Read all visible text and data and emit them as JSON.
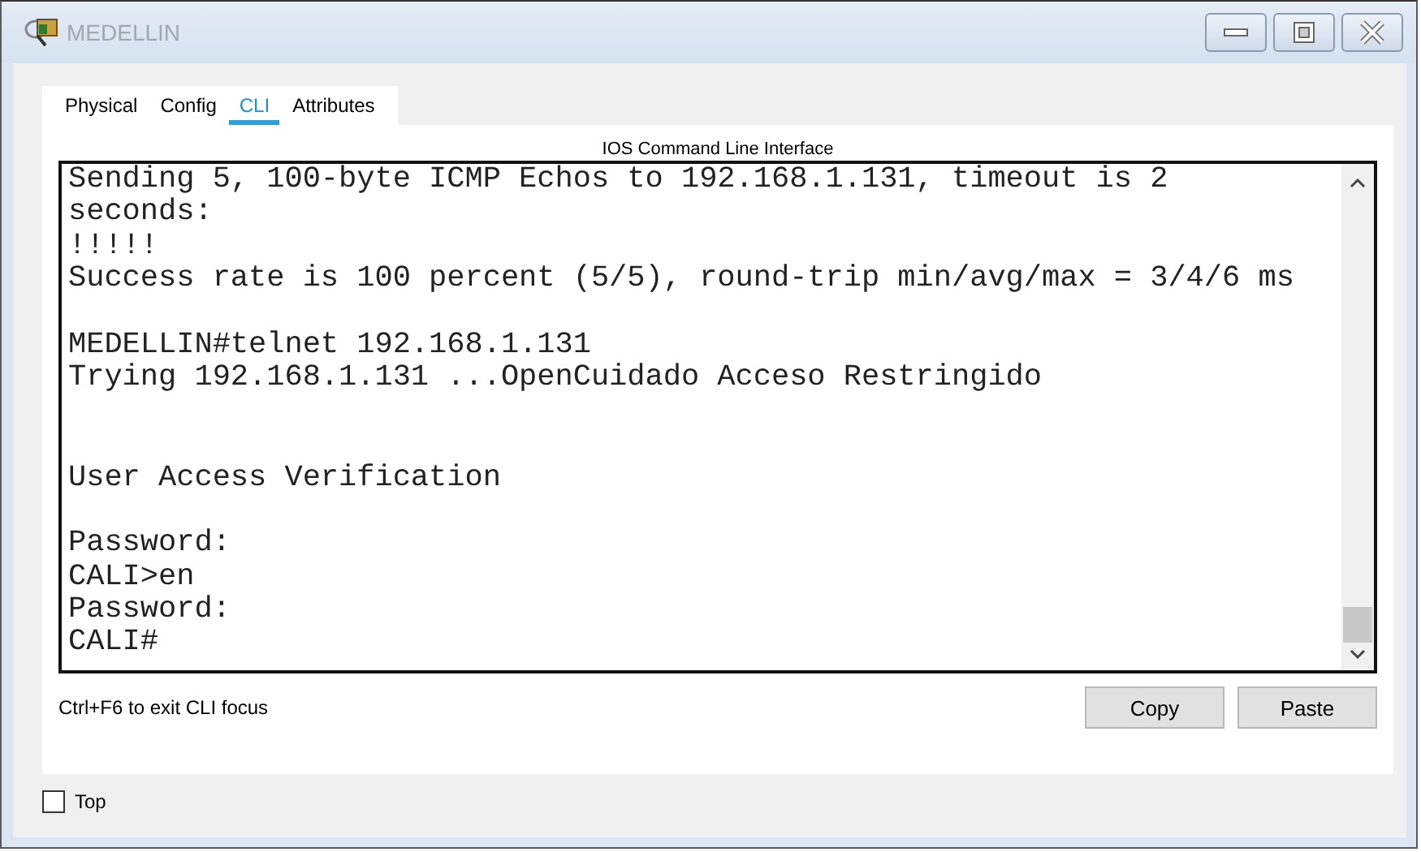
{
  "window": {
    "title": "MEDELLIN"
  },
  "tabs": [
    {
      "label": "Physical",
      "selected": false
    },
    {
      "label": "Config",
      "selected": false
    },
    {
      "label": "CLI",
      "selected": true
    },
    {
      "label": "Attributes",
      "selected": false
    }
  ],
  "cli": {
    "heading": "IOS Command Line Interface",
    "lines": [
      {
        "kind": "text",
        "text": "Sending 5, 100-byte ICMP Echos to 192.168.1.131, timeout is 2"
      },
      {
        "kind": "text",
        "text": "seconds:"
      },
      {
        "kind": "text",
        "text": "!!!!!"
      },
      {
        "kind": "text",
        "text": "Success rate is 100 percent (5/5), round-trip min/avg/max = 3/4/6 ms"
      },
      {
        "kind": "blank"
      },
      {
        "kind": "text",
        "text": "MEDELLIN#telnet 192.168.1.131"
      },
      {
        "kind": "text",
        "text": "Trying 192.168.1.131 ...OpenCuidado Acceso Restringido"
      },
      {
        "kind": "blank"
      },
      {
        "kind": "blank"
      },
      {
        "kind": "text",
        "text": "User Access Verification"
      },
      {
        "kind": "blank"
      },
      {
        "kind": "text",
        "text": "Password:"
      },
      {
        "kind": "text",
        "text": "CALI>en"
      },
      {
        "kind": "text",
        "text": "Password:"
      },
      {
        "kind": "text",
        "text": "CALI#"
      }
    ],
    "hint": "Ctrl+F6 to exit CLI focus",
    "buttons": [
      "Copy",
      "Paste"
    ]
  },
  "top": {
    "label": "Top",
    "checked": false
  }
}
